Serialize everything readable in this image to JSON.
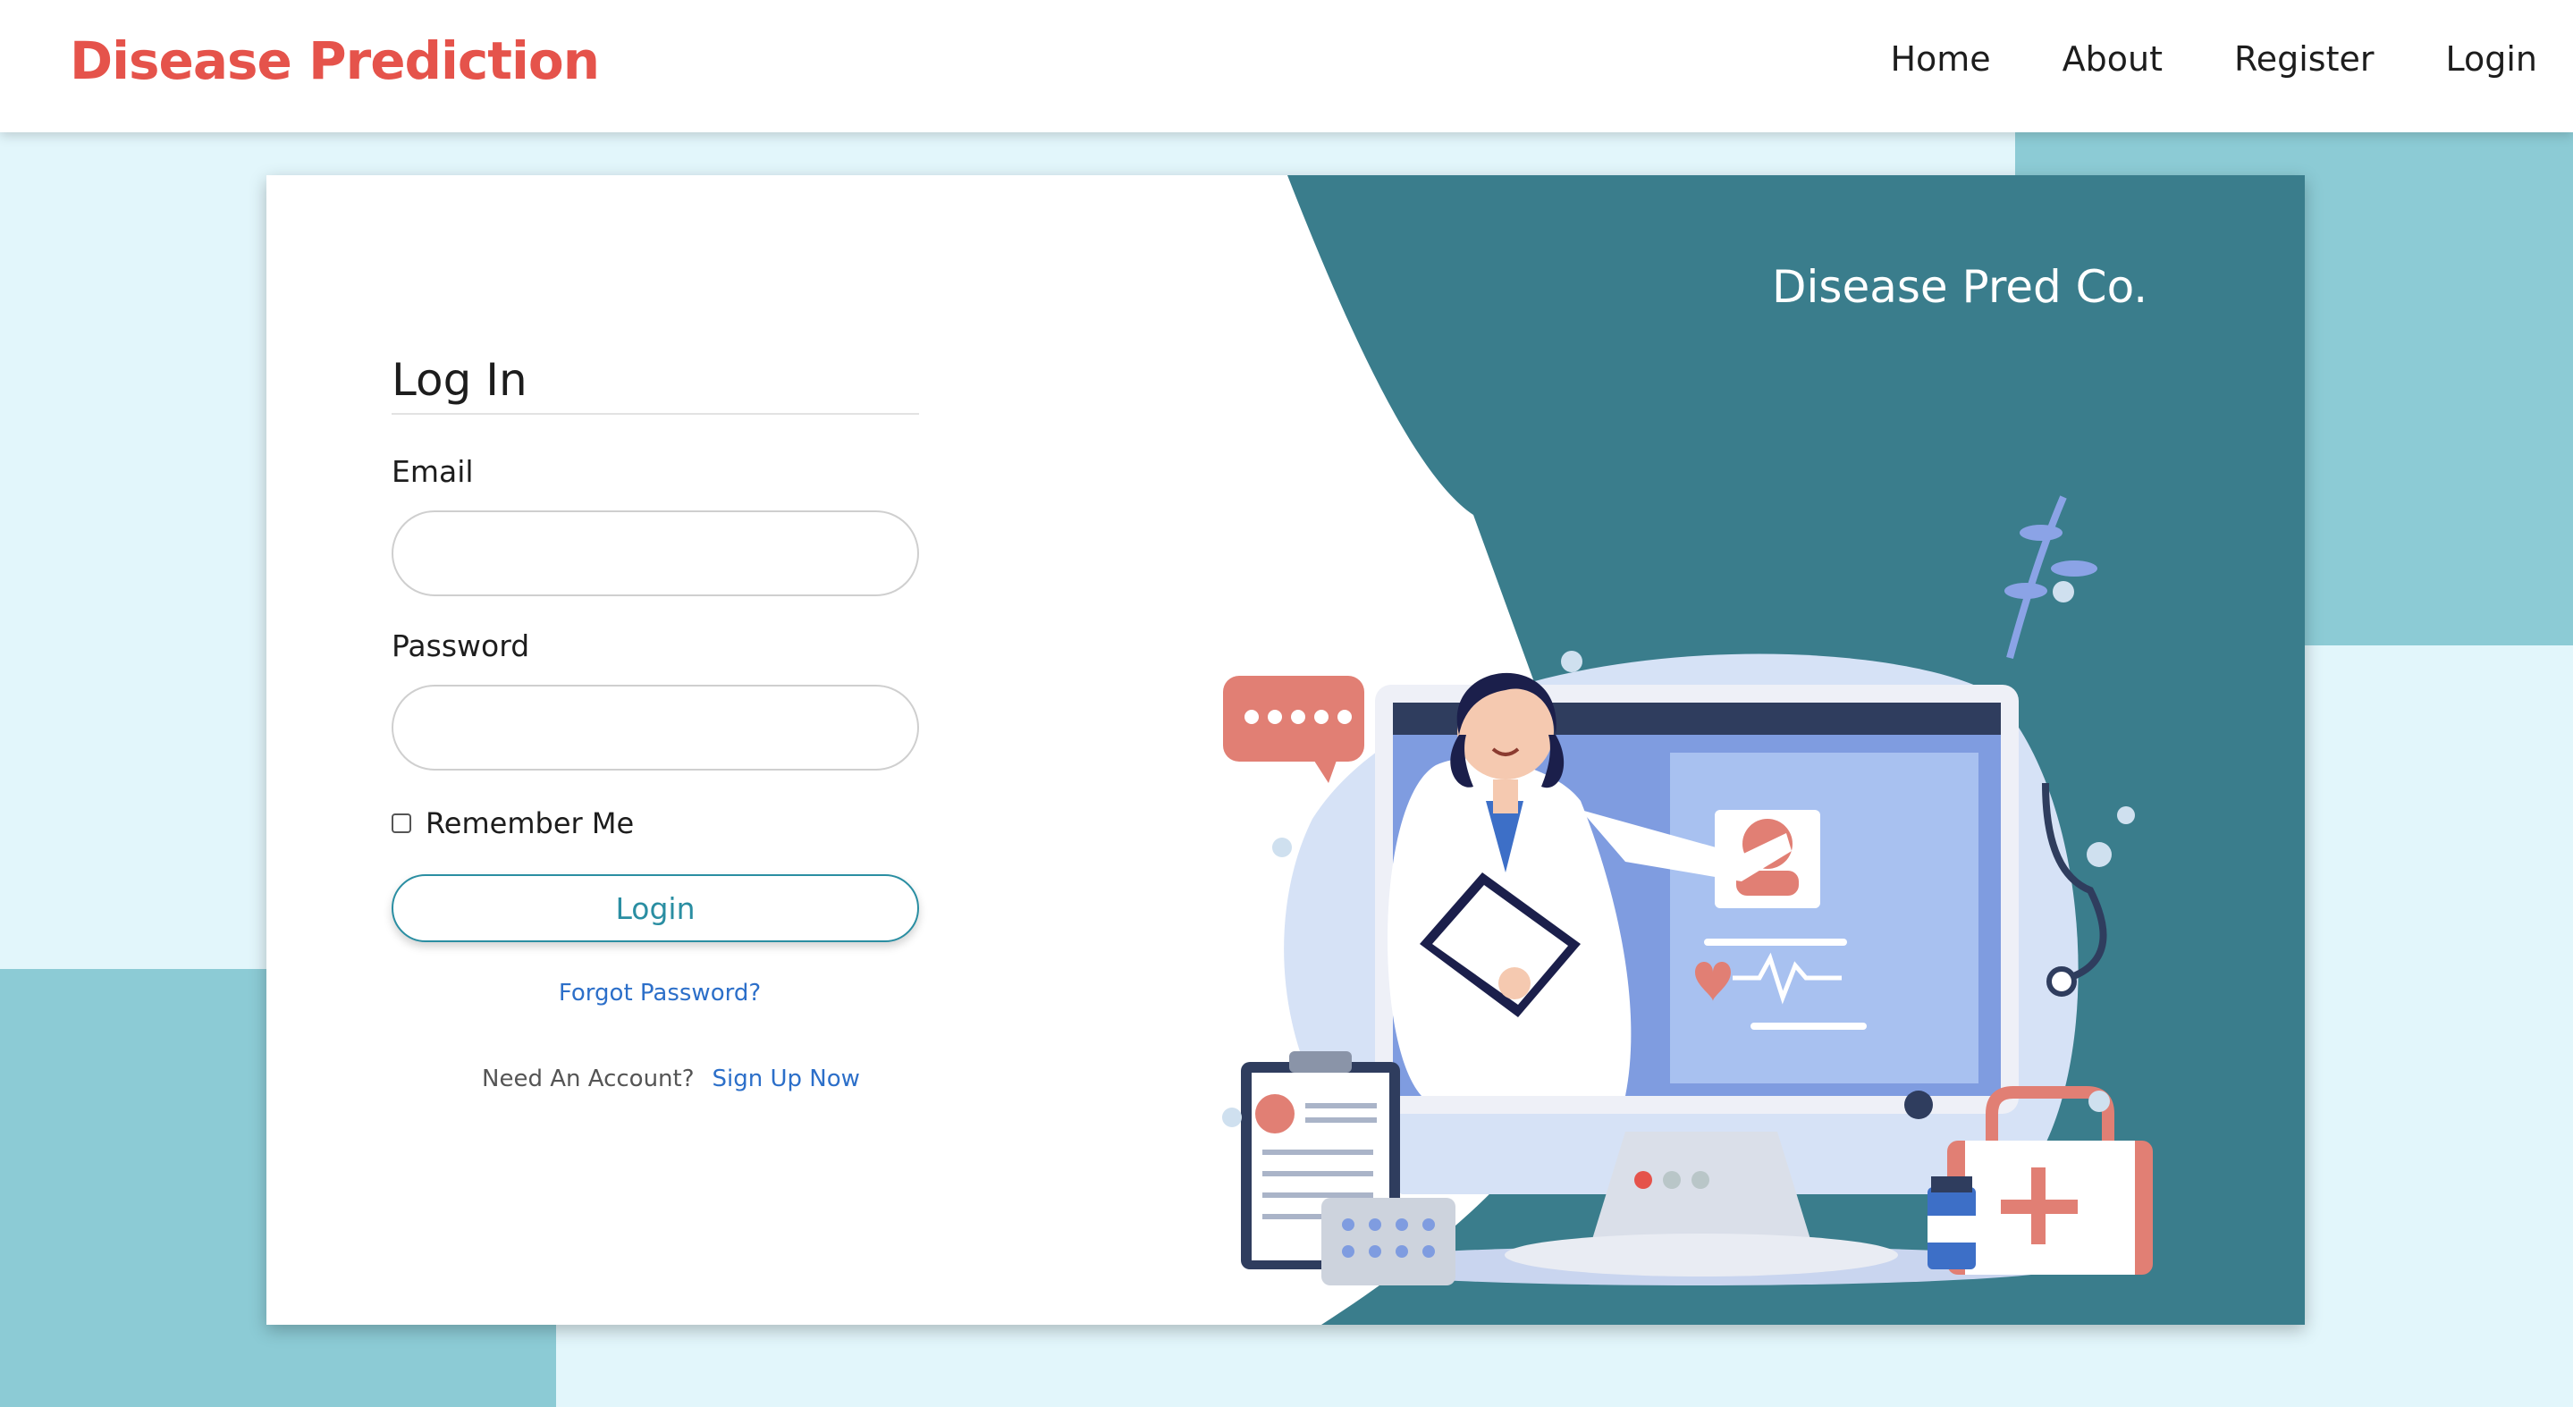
{
  "navbar": {
    "brand": "Disease Prediction",
    "links": [
      "Home",
      "About",
      "Register",
      "Login"
    ]
  },
  "login_form": {
    "title": "Log In",
    "email_label": "Email",
    "email_value": "",
    "password_label": "Password",
    "password_value": "",
    "remember_label": "Remember Me",
    "remember_checked": false,
    "submit_label": "Login",
    "forgot_link": "Forgot Password?",
    "account_prompt": "Need An Account?",
    "signup_link": "Sign Up Now"
  },
  "promo": {
    "company_name": "Disease Pred Co.",
    "carousel_total": 3,
    "carousel_active": 1
  },
  "colors": {
    "brand": "#e5534b",
    "teal": "#3a7d8c",
    "accent": "#2a8ea2",
    "link": "#2c6fc9",
    "page_background": "#e2f6fb",
    "background_blocks": "#8ccbd5"
  }
}
